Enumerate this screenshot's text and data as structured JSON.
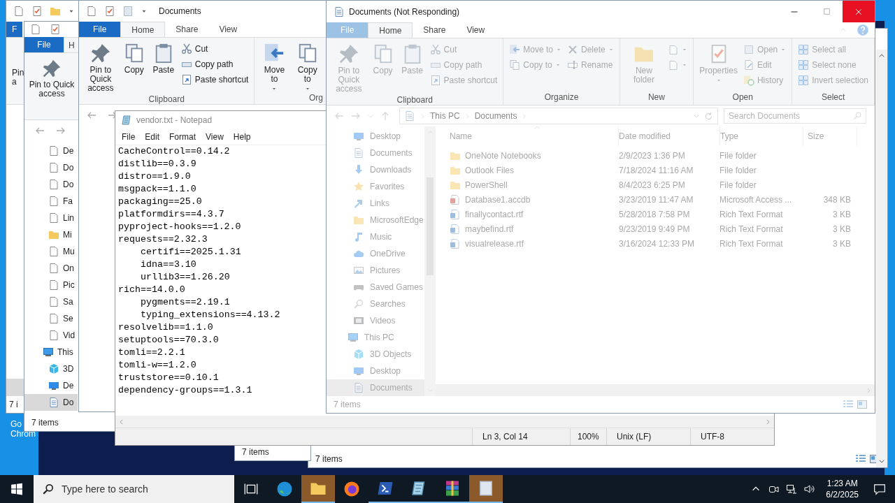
{
  "desktop": {
    "shortcut_label": [
      "Go",
      "Chrom"
    ]
  },
  "explorer_left": {
    "tab": "F",
    "ribbon_label": [
      "Pin",
      "a"
    ],
    "status": "7 i"
  },
  "explorer_middle": {
    "tabs": [
      {
        "label": "File",
        "selected": false
      },
      {
        "label": "H",
        "selected": true
      }
    ],
    "ribbon_button": "Pin to Quick access",
    "nav_items": [
      {
        "label": "De",
        "selected": false
      },
      {
        "label": "Do",
        "selected": false
      },
      {
        "label": "Do",
        "selected": false
      },
      {
        "label": "Fa",
        "selected": false
      },
      {
        "label": "Lin",
        "selected": false
      },
      {
        "label": "Mi",
        "selected": false
      },
      {
        "label": "Mu",
        "selected": false
      },
      {
        "label": "On",
        "selected": false
      },
      {
        "label": "Pic",
        "selected": false
      },
      {
        "label": "Sa",
        "selected": false
      },
      {
        "label": "Se",
        "selected": false
      },
      {
        "label": "Vid",
        "selected": false
      },
      {
        "label": "This",
        "selected": false,
        "children": [
          {
            "label": "3D",
            "selected": false
          },
          {
            "label": "De",
            "selected": false
          },
          {
            "label": "Do",
            "selected": true
          }
        ]
      }
    ],
    "status": "7 items"
  },
  "explorer_back": {
    "title": "Documents",
    "tabs": [
      {
        "label": "File",
        "selected": false
      },
      {
        "label": "Home",
        "selected": true
      },
      {
        "label": "Share",
        "selected": false
      },
      {
        "label": "View",
        "selected": false
      }
    ],
    "ribbon": [
      {
        "label": "Clipboard",
        "columns": [
          {
            "kind": "large",
            "buttons": [
              {
                "label": "Pin to Quick access"
              }
            ]
          },
          {
            "kind": "large",
            "buttons": [
              {
                "label": "Copy"
              }
            ]
          },
          {
            "kind": "large",
            "buttons": [
              {
                "label": "Paste"
              }
            ]
          },
          {
            "kind": "small",
            "buttons": [
              {
                "label": "Cut"
              },
              {
                "label": "Copy path"
              },
              {
                "label": "Paste shortcut"
              }
            ]
          }
        ]
      },
      {
        "label": "Org",
        "columns": [
          {
            "kind": "large",
            "buttons": [
              {
                "label": "Move to",
                "menu": true
              }
            ]
          },
          {
            "kind": "large",
            "buttons": [
              {
                "label": "Copy to",
                "menu": true
              }
            ]
          }
        ]
      }
    ]
  },
  "notepad": {
    "title": "vendor.txt - Notepad",
    "menu": [
      "File",
      "Edit",
      "Format",
      "View",
      "Help"
    ],
    "lines": [
      {
        "text": "CacheControl==0.14.2"
      },
      {
        "text": "distlib==0.3.9"
      },
      {
        "text": "distro==1.9.0"
      },
      {
        "text": "msgpack==1.1.0"
      },
      {
        "text": "packaging==25.0"
      },
      {
        "text": "platformdirs==4.3.7"
      },
      {
        "text": "pyproject-hooks==1.2.0"
      },
      {
        "text": "requests==2.32.3",
        "children": [
          {
            "text": "certifi==2025.1.31"
          },
          {
            "text": "idna==3.10"
          },
          {
            "text": "urllib3==1.26.20"
          }
        ]
      },
      {
        "text": "rich==14.0.0",
        "children": [
          {
            "text": "pygments==2.19.1"
          },
          {
            "text": "typing_extensions==4.13.2"
          }
        ]
      },
      {
        "text": "resolvelib==1.1.0"
      },
      {
        "text": "setuptools==70.3.0"
      },
      {
        "text": "tomli==2.2.1"
      },
      {
        "text": "tomli-w==1.2.0"
      },
      {
        "text": "truststore==0.10.1"
      },
      {
        "text": "dependency-groups==1.3.1"
      }
    ],
    "status": [
      "Ln 3, Col 14",
      "100%",
      "Unix (LF)",
      "UTF-8"
    ]
  },
  "explorer_front": {
    "title": "Documents (Not Responding)",
    "tabs": [
      {
        "label": "File",
        "selected": false
      },
      {
        "label": "Home",
        "selected": true
      },
      {
        "label": "Share",
        "selected": false
      },
      {
        "label": "View",
        "selected": false
      }
    ],
    "ribbon": [
      {
        "label": "Clipboard",
        "columns": [
          {
            "kind": "large",
            "buttons": [
              {
                "label": "Pin to Quick access"
              }
            ]
          },
          {
            "kind": "large",
            "buttons": [
              {
                "label": "Copy"
              }
            ]
          },
          {
            "kind": "large",
            "buttons": [
              {
                "label": "Paste"
              }
            ]
          },
          {
            "kind": "small",
            "buttons": [
              {
                "label": "Cut"
              },
              {
                "label": "Copy path"
              },
              {
                "label": "Paste shortcut"
              }
            ]
          }
        ]
      },
      {
        "label": "Organize",
        "columns": [
          {
            "kind": "small",
            "buttons": [
              {
                "label": "Move to",
                "menu": true
              },
              {
                "label": "Copy to",
                "menu": true
              }
            ]
          },
          {
            "kind": "small",
            "buttons": [
              {
                "label": "Delete",
                "menu": true
              },
              {
                "label": "Rename"
              }
            ]
          }
        ]
      },
      {
        "label": "New",
        "columns": [
          {
            "kind": "large",
            "buttons": [
              {
                "label": "New folder"
              }
            ]
          },
          {
            "kind": "icons",
            "buttons": [
              {
                "menu": true
              },
              {
                "menu": true
              }
            ]
          }
        ]
      },
      {
        "label": "Open",
        "columns": [
          {
            "kind": "large",
            "buttons": [
              {
                "label": "Properties",
                "menu": true
              }
            ]
          },
          {
            "kind": "small",
            "buttons": [
              {
                "label": "Open",
                "menu": true
              },
              {
                "label": "Edit"
              },
              {
                "label": "History"
              }
            ]
          }
        ]
      },
      {
        "label": "Select",
        "columns": [
          {
            "kind": "small",
            "buttons": [
              {
                "label": "Select all"
              },
              {
                "label": "Select none"
              },
              {
                "label": "Invert selection"
              }
            ]
          }
        ]
      }
    ],
    "path": [
      "This PC",
      "Documents"
    ],
    "search_placeholder": "Search Documents",
    "nav_items": [
      {
        "label": "Desktop",
        "selected": false
      },
      {
        "label": "Documents",
        "selected": false
      },
      {
        "label": "Downloads",
        "selected": false
      },
      {
        "label": "Favorites",
        "selected": false
      },
      {
        "label": "Links",
        "selected": false
      },
      {
        "label": "MicrosoftEdge",
        "selected": false
      },
      {
        "label": "Music",
        "selected": false
      },
      {
        "label": "OneDrive",
        "selected": false
      },
      {
        "label": "Pictures",
        "selected": false
      },
      {
        "label": "Saved Games",
        "selected": false
      },
      {
        "label": "Searches",
        "selected": false
      },
      {
        "label": "Videos",
        "selected": false
      },
      {
        "label": "This PC",
        "selected": false,
        "children": [
          {
            "label": "3D Objects",
            "selected": false
          },
          {
            "label": "Desktop",
            "selected": false
          },
          {
            "label": "Documents",
            "selected": true
          }
        ]
      }
    ],
    "columns": [
      "Name",
      "Date modified",
      "Type",
      "Size"
    ],
    "files": [
      {
        "kind": "folder",
        "name": "OneNote Notebooks",
        "date": "2/9/2023 1:36 PM",
        "type": "File folder"
      },
      {
        "kind": "folder",
        "name": "Outlook Files",
        "date": "7/18/2024 11:16 AM",
        "type": "File folder"
      },
      {
        "kind": "folder",
        "name": "PowerShell",
        "date": "8/4/2023 6:25 PM",
        "type": "File folder"
      },
      {
        "kind": "database",
        "name": "Database1.accdb",
        "date": "3/23/2019 11:47 AM",
        "type": "Microsoft Access ...",
        "size": "348 KB"
      },
      {
        "kind": "document",
        "name": "finallycontact.rtf",
        "date": "5/28/2018 7:58 PM",
        "type": "Rich Text Format",
        "size": "3 KB"
      },
      {
        "kind": "document",
        "name": "maybefind.rtf",
        "date": "9/23/2019 9:49 PM",
        "type": "Rich Text Format",
        "size": "3 KB"
      },
      {
        "kind": "document",
        "name": "visualrelease.rtf",
        "date": "3/16/2024 12:33 PM",
        "type": "Rich Text Format",
        "size": "3 KB"
      }
    ],
    "status": "7 items"
  },
  "explorer_small": {
    "status": "7 items"
  },
  "explorer_lower": {
    "status": "7 items"
  },
  "taskbar": {
    "search_placeholder": "Type here to search",
    "apps": [
      {
        "running": false,
        "flashing": false
      },
      {
        "running": true,
        "flashing": true
      },
      {
        "running": false,
        "flashing": false
      },
      {
        "running": true,
        "flashing": false
      },
      {
        "running": true,
        "flashing": false
      },
      {
        "running": true,
        "flashing": false
      },
      {
        "running": true,
        "flashing": true
      }
    ],
    "time": "1:23 AM",
    "date": "6/2/2025"
  }
}
